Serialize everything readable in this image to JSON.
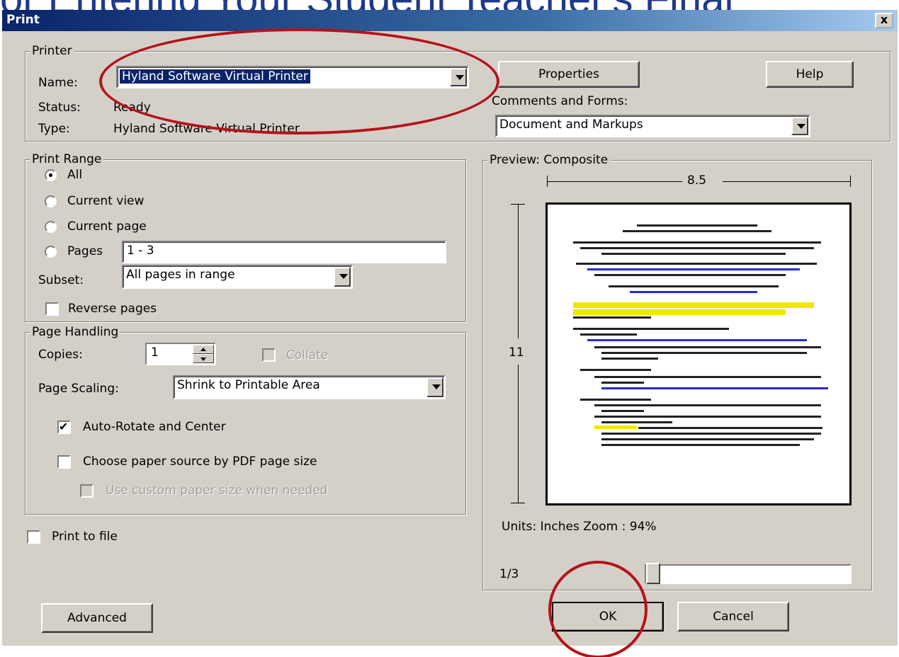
{
  "background_title": "or Entering Your Student Teacher's Final",
  "window": {
    "title": "Print",
    "close_label": "x"
  },
  "printer": {
    "legend": "Printer",
    "name_label": "Name:",
    "name_value": "Hyland Software Virtual Printer",
    "status_label": "Status:",
    "status_value": "Ready",
    "type_label": "Type:",
    "type_value": "Hyland Software Virtual Printer",
    "properties_button": "Properties",
    "help_button": "Help",
    "comments_label": "Comments and Forms:",
    "comments_value": "Document and Markups"
  },
  "print_range": {
    "legend": "Print Range",
    "options": [
      "All",
      "Current view",
      "Current page",
      "Pages"
    ],
    "selected": "All",
    "pages_value": "1 - 3",
    "subset_label": "Subset:",
    "subset_value": "All pages in range",
    "reverse_label": "Reverse pages"
  },
  "page_handling": {
    "legend": "Page Handling",
    "copies_label": "Copies:",
    "copies_value": "1",
    "collate_label": "Collate",
    "scaling_label": "Page Scaling:",
    "scaling_value": "Shrink to Printable Area",
    "auto_rotate_label": "Auto-Rotate and Center",
    "auto_rotate_checked": true,
    "paper_source_label": "Choose paper source by PDF page size",
    "custom_size_label": "Use custom paper size when needed"
  },
  "print_to_file_label": "Print to file",
  "preview": {
    "legend": "Preview: Composite",
    "width_label": "8.5",
    "height_label": "11",
    "units_zoom": "Units: Inches Zoom :  94%",
    "page_indicator": "1/3"
  },
  "buttons": {
    "advanced": "Advanced",
    "ok": "OK",
    "cancel": "Cancel"
  },
  "colors": {
    "annotation": "#b5121b",
    "selection": "#0a246a",
    "dialog_bg": "#d4d0c8"
  }
}
